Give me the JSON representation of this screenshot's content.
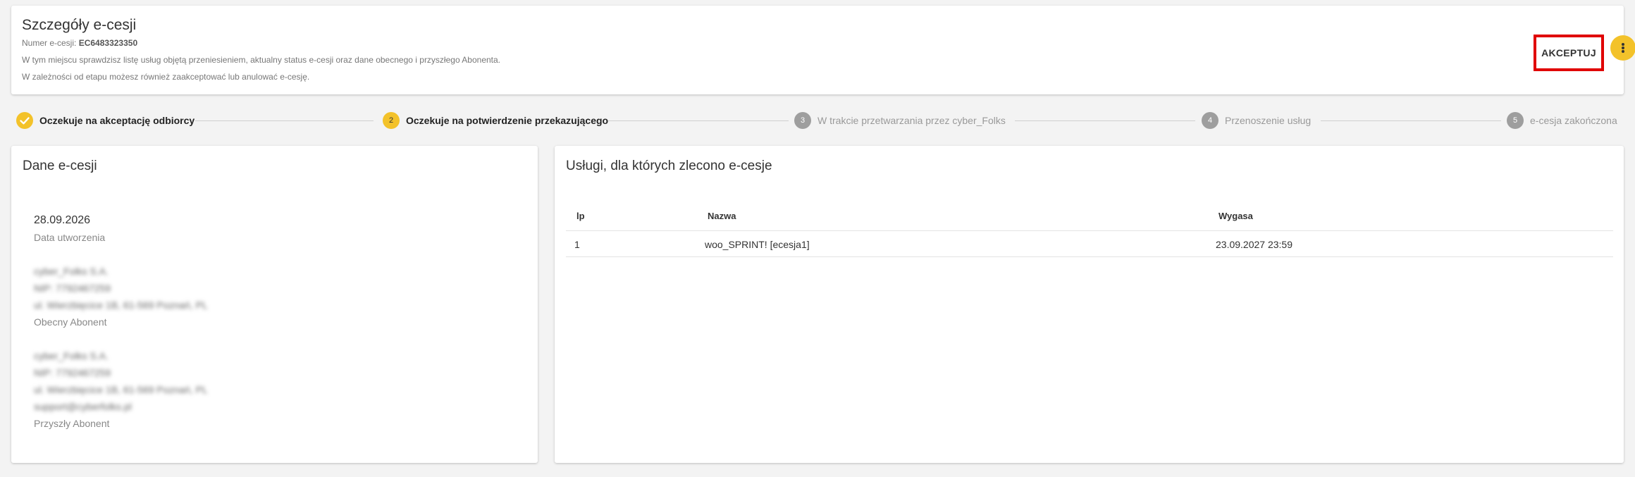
{
  "header": {
    "title": "Szczegóły e-cesji",
    "number_label": "Numer e-cesji:",
    "number_value": "EC6483323350",
    "line1": "W tym miejscu sprawdzisz listę usług objętą przeniesieniem, aktualny status e-cesji oraz dane obecnego i przyszłego Abonenta.",
    "line2": "W zależności od etapu możesz również zaakceptować lub anulować e-cesję.",
    "accept_label": "AKCEPTUJ",
    "more_icon": "more-vertical-icon"
  },
  "stepper": {
    "steps": [
      {
        "num": "",
        "label": "Oczekuje na akceptację odbiorcy",
        "state": "done"
      },
      {
        "num": "2",
        "label": "Oczekuje na potwierdzenie przekazującego",
        "state": "active"
      },
      {
        "num": "3",
        "label": "W trakcie przetwarzania przez cyber_Folks",
        "state": "todo"
      },
      {
        "num": "4",
        "label": "Przenoszenie usług",
        "state": "todo"
      },
      {
        "num": "5",
        "label": "e-cesja zakończona",
        "state": "todo"
      }
    ]
  },
  "details": {
    "title": "Dane e-cesji",
    "date_value": "28.09.2026",
    "date_label": "Data utworzenia",
    "current": {
      "lines": [
        "cyber_Folks S.A.",
        "NIP: 7792467259",
        "ul. Wierzbięcice 1B, 61-569 Poznań, PL"
      ],
      "label": "Obecny Abonent"
    },
    "future": {
      "lines": [
        "cyber_Folks S.A.",
        "NIP: 7792467259",
        "ul. Wierzbięcice 1B, 61-569 Poznań, PL",
        "support@cyberfolks.pl"
      ],
      "label": "Przyszły Abonent"
    }
  },
  "services": {
    "title": "Usługi, dla których zlecono e-cesje",
    "columns": {
      "lp": "lp",
      "name": "Nazwa",
      "expires": "Wygasa"
    },
    "rows": [
      {
        "lp": "1",
        "name": "woo_SPRINT! [ecesja1]",
        "expires": "23.09.2027 23:59"
      }
    ]
  },
  "colors": {
    "accent": "#f3c22a",
    "highlight": "#e00000",
    "step_todo": "#9e9e9e"
  }
}
